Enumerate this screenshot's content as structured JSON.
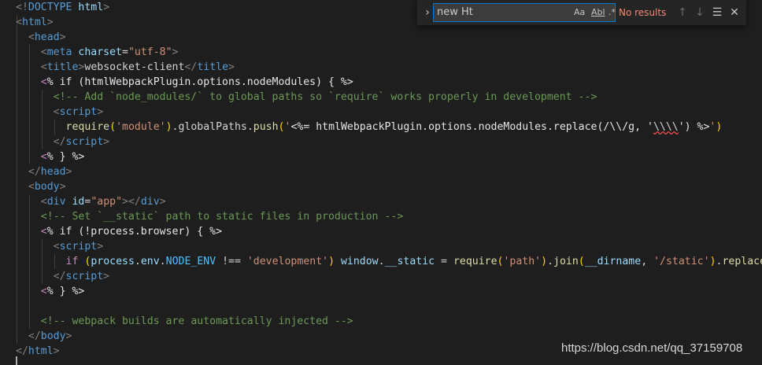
{
  "editor": {
    "lines": [
      {
        "segments": [
          {
            "t": "<!",
            "c": "punc"
          },
          {
            "t": "DOCTYPE ",
            "c": "tag"
          },
          {
            "t": "html",
            "c": "attr"
          },
          {
            "t": ">",
            "c": "punc"
          }
        ]
      },
      {
        "segments": [
          {
            "t": "<",
            "c": "punc"
          },
          {
            "t": "html",
            "c": "tag"
          },
          {
            "t": ">",
            "c": "punc"
          }
        ]
      },
      {
        "segments": [
          {
            "t": "  ",
            "c": "plain"
          },
          {
            "t": "<",
            "c": "punc"
          },
          {
            "t": "head",
            "c": "tag"
          },
          {
            "t": ">",
            "c": "punc"
          }
        ]
      },
      {
        "segments": [
          {
            "t": "    ",
            "c": "plain"
          },
          {
            "t": "<",
            "c": "punc"
          },
          {
            "t": "meta ",
            "c": "tag"
          },
          {
            "t": "charset",
            "c": "attr"
          },
          {
            "t": "=",
            "c": "plain"
          },
          {
            "t": "\"utf-8\"",
            "c": "str"
          },
          {
            "t": ">",
            "c": "punc"
          }
        ]
      },
      {
        "segments": [
          {
            "t": "    ",
            "c": "plain"
          },
          {
            "t": "<",
            "c": "punc"
          },
          {
            "t": "title",
            "c": "tag"
          },
          {
            "t": ">",
            "c": "punc"
          },
          {
            "t": "websocket-client",
            "c": "plain"
          },
          {
            "t": "</",
            "c": "punc"
          },
          {
            "t": "title",
            "c": "tag"
          },
          {
            "t": ">",
            "c": "punc"
          }
        ]
      },
      {
        "segments": [
          {
            "t": "    ",
            "c": "plain"
          },
          {
            "t": "<",
            "c": "kw"
          },
          {
            "t": "% if (htmlWebpackPlugin.options.nodeModules) { %>",
            "c": "tpl"
          }
        ]
      },
      {
        "segments": [
          {
            "t": "      ",
            "c": "plain"
          },
          {
            "t": "<!-- Add `node_modules/` to global paths so `require` works properly in development -->",
            "c": "cmt"
          }
        ]
      },
      {
        "segments": [
          {
            "t": "      ",
            "c": "plain"
          },
          {
            "t": "<",
            "c": "punc"
          },
          {
            "t": "script",
            "c": "tag"
          },
          {
            "t": ">",
            "c": "punc"
          }
        ]
      },
      {
        "segments": [
          {
            "t": "        ",
            "c": "plain"
          },
          {
            "t": "require",
            "c": "fn"
          },
          {
            "t": "(",
            "c": "paren"
          },
          {
            "t": "'module'",
            "c": "str"
          },
          {
            "t": ")",
            "c": "paren"
          },
          {
            "t": ".globalPaths.",
            "c": "plain"
          },
          {
            "t": "push",
            "c": "fn"
          },
          {
            "t": "(",
            "c": "paren"
          },
          {
            "t": "'",
            "c": "str"
          },
          {
            "t": "<%= htmlWebpackPlugin.options.nodeModules.replace(/\\\\/g, '",
            "c": "tpl"
          },
          {
            "t": "\\\\\\\\",
            "c": "squig"
          },
          {
            "t": "') %>",
            "c": "tpl"
          },
          {
            "t": "'",
            "c": "str"
          },
          {
            "t": ")",
            "c": "paren"
          }
        ]
      },
      {
        "segments": [
          {
            "t": "      ",
            "c": "plain"
          },
          {
            "t": "</",
            "c": "punc"
          },
          {
            "t": "script",
            "c": "tag"
          },
          {
            "t": ">",
            "c": "punc"
          }
        ]
      },
      {
        "segments": [
          {
            "t": "    ",
            "c": "plain"
          },
          {
            "t": "<",
            "c": "kw"
          },
          {
            "t": "% } %>",
            "c": "tpl"
          }
        ]
      },
      {
        "segments": [
          {
            "t": "  ",
            "c": "plain"
          },
          {
            "t": "</",
            "c": "punc"
          },
          {
            "t": "head",
            "c": "tag"
          },
          {
            "t": ">",
            "c": "punc"
          }
        ]
      },
      {
        "segments": [
          {
            "t": "  ",
            "c": "plain"
          },
          {
            "t": "<",
            "c": "punc"
          },
          {
            "t": "body",
            "c": "tag"
          },
          {
            "t": ">",
            "c": "punc"
          }
        ]
      },
      {
        "segments": [
          {
            "t": "    ",
            "c": "plain"
          },
          {
            "t": "<",
            "c": "punc"
          },
          {
            "t": "div ",
            "c": "tag"
          },
          {
            "t": "id",
            "c": "attr"
          },
          {
            "t": "=",
            "c": "plain"
          },
          {
            "t": "\"app\"",
            "c": "str"
          },
          {
            "t": "></",
            "c": "punc"
          },
          {
            "t": "div",
            "c": "tag"
          },
          {
            "t": ">",
            "c": "punc"
          }
        ]
      },
      {
        "segments": [
          {
            "t": "    ",
            "c": "plain"
          },
          {
            "t": "<!-- Set `__static` path to static files in production -->",
            "c": "cmt"
          }
        ]
      },
      {
        "segments": [
          {
            "t": "    ",
            "c": "plain"
          },
          {
            "t": "<",
            "c": "kw"
          },
          {
            "t": "% if (!process.browser) { %>",
            "c": "tpl"
          }
        ]
      },
      {
        "segments": [
          {
            "t": "      ",
            "c": "plain"
          },
          {
            "t": "<",
            "c": "punc"
          },
          {
            "t": "script",
            "c": "tag"
          },
          {
            "t": ">",
            "c": "punc"
          }
        ]
      },
      {
        "segments": [
          {
            "t": "        ",
            "c": "plain"
          },
          {
            "t": "if ",
            "c": "kw"
          },
          {
            "t": "(",
            "c": "paren"
          },
          {
            "t": "process",
            "c": "id"
          },
          {
            "t": ".",
            "c": "plain"
          },
          {
            "t": "env",
            "c": "id"
          },
          {
            "t": ".",
            "c": "plain"
          },
          {
            "t": "NODE_ENV",
            "c": "const"
          },
          {
            "t": " !== ",
            "c": "plain"
          },
          {
            "t": "'development'",
            "c": "str"
          },
          {
            "t": ")",
            "c": "paren"
          },
          {
            "t": " ",
            "c": "plain"
          },
          {
            "t": "window",
            "c": "id"
          },
          {
            "t": ".",
            "c": "plain"
          },
          {
            "t": "__static",
            "c": "id"
          },
          {
            "t": " = ",
            "c": "plain"
          },
          {
            "t": "require",
            "c": "fn"
          },
          {
            "t": "(",
            "c": "paren"
          },
          {
            "t": "'path'",
            "c": "str"
          },
          {
            "t": ")",
            "c": "paren"
          },
          {
            "t": ".",
            "c": "plain"
          },
          {
            "t": "join",
            "c": "fn"
          },
          {
            "t": "(",
            "c": "paren"
          },
          {
            "t": "__dirname",
            "c": "id"
          },
          {
            "t": ", ",
            "c": "plain"
          },
          {
            "t": "'/static'",
            "c": "str"
          },
          {
            "t": ")",
            "c": "paren"
          },
          {
            "t": ".",
            "c": "plain"
          },
          {
            "t": "replace",
            "c": "fn"
          },
          {
            "t": "(",
            "c": "paren"
          },
          {
            "t": "/\\",
            "c": "str"
          }
        ]
      },
      {
        "segments": [
          {
            "t": "      ",
            "c": "plain"
          },
          {
            "t": "</",
            "c": "punc"
          },
          {
            "t": "script",
            "c": "tag"
          },
          {
            "t": ">",
            "c": "punc"
          }
        ]
      },
      {
        "segments": [
          {
            "t": "    ",
            "c": "plain"
          },
          {
            "t": "<",
            "c": "kw"
          },
          {
            "t": "% } %>",
            "c": "tpl"
          }
        ]
      },
      {
        "segments": [
          {
            "t": "",
            "c": "plain"
          }
        ]
      },
      {
        "segments": [
          {
            "t": "    ",
            "c": "plain"
          },
          {
            "t": "<!-- webpack builds are automatically injected -->",
            "c": "cmt"
          }
        ]
      },
      {
        "segments": [
          {
            "t": "  ",
            "c": "plain"
          },
          {
            "t": "</",
            "c": "punc"
          },
          {
            "t": "body",
            "c": "tag"
          },
          {
            "t": ">",
            "c": "punc"
          }
        ]
      },
      {
        "segments": [
          {
            "t": "</",
            "c": "punc"
          },
          {
            "t": "html",
            "c": "tag"
          },
          {
            "t": ">",
            "c": "punc"
          }
        ]
      }
    ]
  },
  "find": {
    "query": "new Ht",
    "match_case_label": "Aa",
    "whole_word_label": "Abl",
    "regex_label": ".*",
    "status": "No results",
    "toggle_icon": "chevron-right-icon",
    "prev_icon": "arrow-up-icon",
    "next_icon": "arrow-down-icon",
    "selection_icon": "find-in-selection-icon",
    "close_icon": "close-icon"
  },
  "watermark": "https://blog.csdn.net/qq_37159708"
}
